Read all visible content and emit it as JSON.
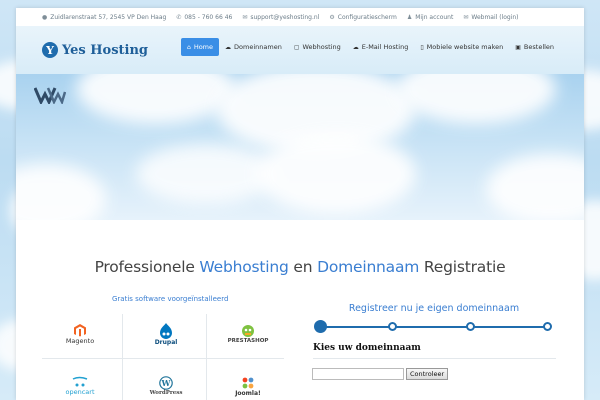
{
  "topbar": {
    "address": "Zuidlarenstraat 57, 2545 VP Den Haag",
    "phone": "085 - 760 66 46",
    "email": "support@yeshosting.nl",
    "config": "Configuratiescherm",
    "account": "Mijn account",
    "webmail": "Webmail (login)"
  },
  "logo": {
    "mark": "Y",
    "text": "Yes Hosting"
  },
  "nav": [
    {
      "label": "Home",
      "icon": "home-icon",
      "active": true
    },
    {
      "label": "Domeinnamen",
      "icon": "cloud-icon"
    },
    {
      "label": "Webhosting",
      "icon": "folder-icon"
    },
    {
      "label": "E-Mail Hosting",
      "icon": "cloud-upload-icon"
    },
    {
      "label": "Mobiele website maken",
      "icon": "mobile-icon"
    },
    {
      "label": "Bestellen",
      "icon": "briefcase-icon"
    }
  ],
  "headline": {
    "part1": "Professionele ",
    "hl1": "Webhosting",
    "part2": " en ",
    "hl2": "Domeinnaam",
    "part3": " Registratie"
  },
  "software": {
    "title": "Gratis software voorgeïnstalleerd",
    "items": [
      {
        "label": "Magento",
        "color": "#f26322"
      },
      {
        "label": "Drupal",
        "color": "#0077c0"
      },
      {
        "label": "PRESTASHOP",
        "color": "#df0067"
      },
      {
        "label": "opencart",
        "color": "#23a1d1"
      },
      {
        "label": "WordPress",
        "color": "#21759b"
      },
      {
        "label": "Joomla!",
        "color": "#f44321"
      }
    ]
  },
  "register": {
    "title": "Registreer nu je eigen domeinnaam",
    "steps": 4,
    "current_step": 1,
    "heading": "Kies uw domeinnaam",
    "input_value": "",
    "button_label": "Controleer"
  },
  "colors": {
    "accent": "#3a8ee6",
    "brand": "#1f6cad",
    "link": "#3a7ed1"
  }
}
